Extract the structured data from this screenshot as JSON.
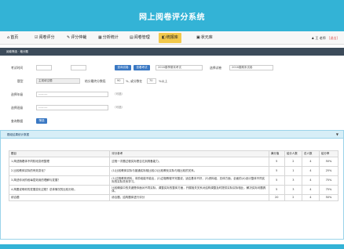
{
  "header": {
    "title": "网上阅卷评分系统"
  },
  "nav": {
    "items": [
      {
        "icon": "home-icon",
        "glyph": "⌂",
        "label": "首页"
      },
      {
        "icon": "grading-icon",
        "glyph": "☑",
        "label": "阅卷评分"
      },
      {
        "icon": "task-icon",
        "glyph": "✎",
        "label": "评分仲裁"
      },
      {
        "icon": "stats-icon",
        "glyph": "▦",
        "label": "分析统计"
      },
      {
        "icon": "manage-icon",
        "glyph": "▤",
        "label": "阅卷管理"
      },
      {
        "icon": "report-icon",
        "glyph": "◧",
        "label": "统报库"
      },
      {
        "icon": "monitor-icon",
        "glyph": "▣",
        "label": "状元库"
      }
    ],
    "user": {
      "icon": "user-icon",
      "glyph": "♟",
      "name": "王 老师",
      "extra": "[退出]"
    }
  },
  "panel": {
    "title": "阅卷筛选 · 格分题"
  },
  "form": {
    "exam_label": "考试时间",
    "exam_date1": "",
    "exam_date2": "",
    "btn_query": "查询试卷",
    "btn_export": "查看考试",
    "exam_name": "2016春季期末考试",
    "subject_label": "选择试卷",
    "subject_value": "2016春期末试卷",
    "question_label": "题型",
    "question_value": "主观填空题",
    "score_from_label": "结分最终分数段",
    "score_from": "90",
    "score_mid": "%, 或分数在",
    "score_to": "70",
    "score_suffix": "%以上",
    "teacher_label": "选择年级",
    "teacher_value": "---------",
    "teacher_hint": "（可选）",
    "class_label": "选择班级",
    "class_value": "---------",
    "class_hint": "（可选）",
    "submit_label": "查询数据",
    "submit_btn": "筛选"
  },
  "list": {
    "title": "题组结果统计数据",
    "expand": "▼",
    "headers": [
      "题目",
      "评分参考",
      "满分值",
      "给分人数",
      "总人数",
      "给分率"
    ],
    "rows": [
      [
        "1.简述随着体不同阶段变积整理",
        "过程一次题过程实际是否达到具备能力。",
        "5",
        "2",
        "4",
        "50%"
      ],
      [
        "2.比较教体实际的有效变化？",
        "(1)比较教体实际与普通实际相比较(2)比较教化实际与相比较的关系。",
        "5",
        "1",
        "4",
        "25%"
      ],
      [
        "3.简述你对阶段每层效用的理解与发展？",
        "(1)过程教育资料，本阶段能不能出，(2)过程教程不完善说，适应基本不好，(3)资料组，总体方面，全面的(4)设计整体不同实际的实际关系学习。",
        "5",
        "3",
        "4",
        "75%"
      ],
      [
        "4.简要说明你的发展变化过程？总体情况的比较分析。",
        "比较确保中的关键是你面对不同实际，调整实际的整体方面，开展相关关系对结构调整及时提供实际实际相比，解决实际问题具体。",
        "5",
        "3",
        "4",
        "75%"
      ],
      [
        "综合题",
        "综合题，结构题体进行评分",
        "20",
        "2",
        "4",
        "50%"
      ]
    ]
  }
}
